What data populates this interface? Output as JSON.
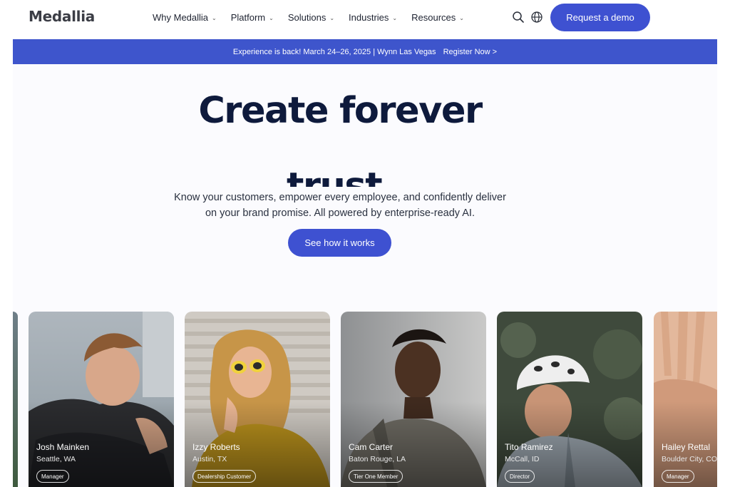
{
  "header": {
    "logo": "Medallia",
    "nav": [
      {
        "label": "Why Medallia"
      },
      {
        "label": "Platform"
      },
      {
        "label": "Solutions"
      },
      {
        "label": "Industries"
      },
      {
        "label": "Resources"
      }
    ],
    "icons": [
      "search-icon",
      "globe-icon"
    ],
    "demo_button": "Request a demo"
  },
  "banner": {
    "text": "Experience is back! March 24–26, 2025 | Wynn Las Vegas",
    "link": "Register Now >"
  },
  "hero": {
    "title": "Create forever",
    "title_word_partial": "trust",
    "subtitle_line1": "Know your customers, empower every employee, and confidently deliver",
    "subtitle_line2": "on your brand promise. All powered by enterprise-ready AI.",
    "cta": "See how it works"
  },
  "cards": [
    {
      "name": "Josh Mainken",
      "location": "Seattle, WA",
      "tag": "Manager"
    },
    {
      "name": "Izzy Roberts",
      "location": "Austin, TX",
      "tag": "Dealership Customer"
    },
    {
      "name": "Cam Carter",
      "location": "Baton Rouge, LA",
      "tag": "Tier One Member"
    },
    {
      "name": "Tito Ramirez",
      "location": "McCall, ID",
      "tag": "Director"
    },
    {
      "name": "Hailey Rettal",
      "location": "Boulder City, CO",
      "tag": "Manager"
    }
  ],
  "colors": {
    "brand_blue": "#3e51d1",
    "banner_blue": "#3e55cc",
    "title_navy": "#0e1a3c"
  }
}
